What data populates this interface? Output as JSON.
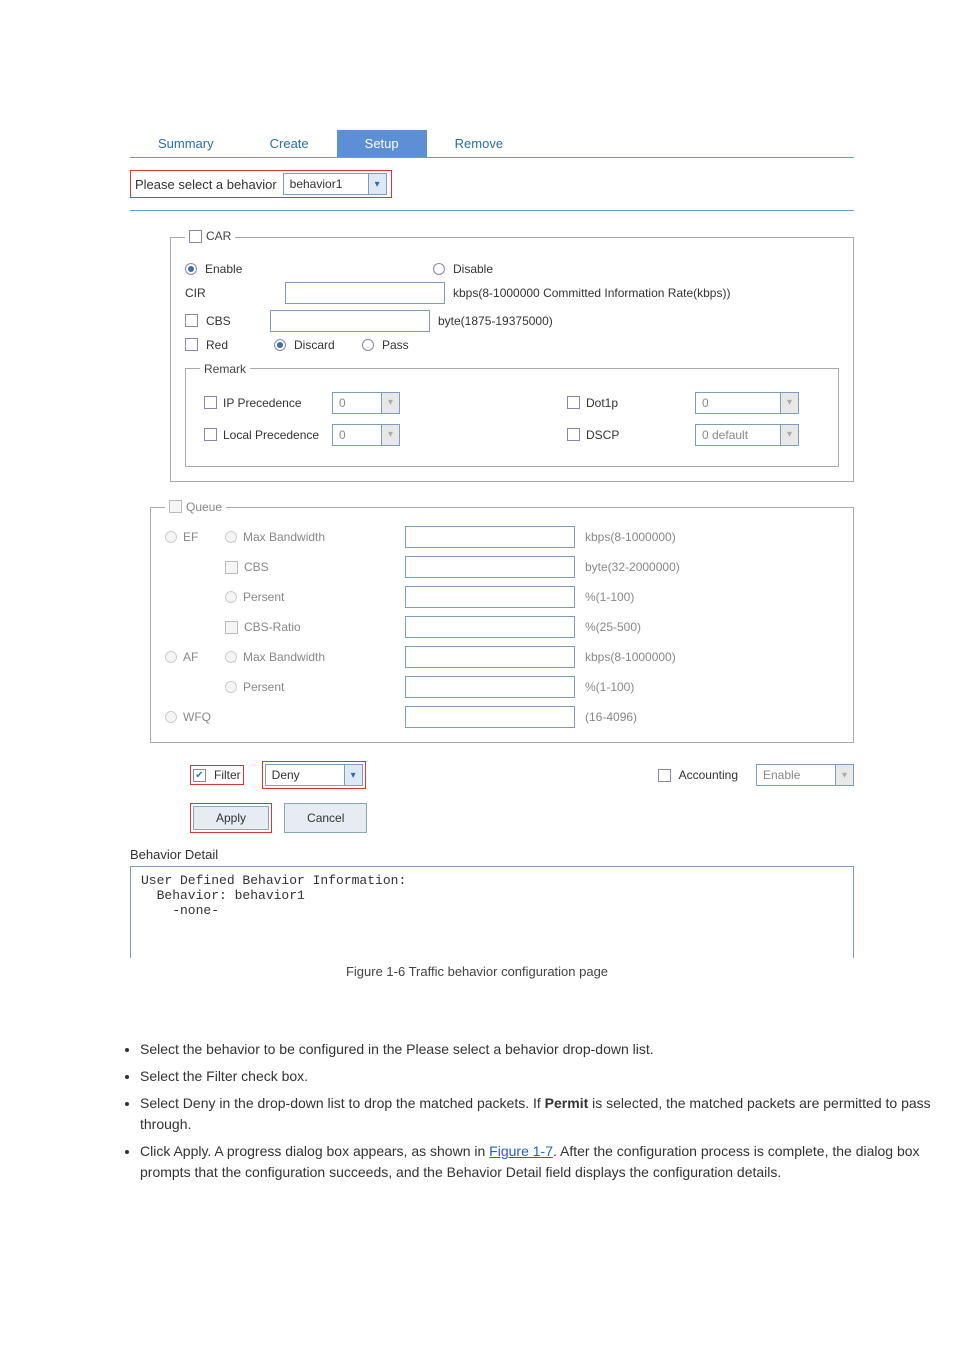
{
  "tabs": {
    "summary": "Summary",
    "create": "Create",
    "setup": "Setup",
    "remove": "Remove"
  },
  "select_label": "Please select a behavior",
  "behavior_value": "behavior1",
  "car": {
    "legend": "CAR",
    "enable": "Enable",
    "disable": "Disable",
    "cir_label": "CIR",
    "cir_unit": "kbps(8-1000000 Committed Information Rate(kbps))",
    "cbs_label": "CBS",
    "cbs_unit": "byte(1875-19375000)",
    "red_label": "Red",
    "discard": "Discard",
    "pass": "Pass"
  },
  "remark": {
    "legend": "Remark",
    "ip_precedence": "IP Precedence",
    "ip_val": "0",
    "dot1p": "Dot1p",
    "dot1p_val": "0",
    "local_precedence": "Local Precedence",
    "local_val": "0",
    "dscp": "DSCP",
    "dscp_val": "0 default"
  },
  "queue": {
    "legend": "Queue",
    "ef": "EF",
    "af": "AF",
    "wfq": "WFQ",
    "max_bw": "Max Bandwidth",
    "cbs": "CBS",
    "persent": "Persent",
    "cbs_ratio": "CBS-Ratio",
    "u_kbps": "kbps(8-1000000)",
    "u_byte": "byte(32-2000000)",
    "u_pct100": "%(1-100)",
    "u_pct500": "%(25-500)",
    "u_wfq": "(16-4096)"
  },
  "filter": {
    "label": "Filter",
    "value": "Deny",
    "accounting": "Accounting",
    "acct_value": "Enable"
  },
  "buttons": {
    "apply": "Apply",
    "cancel": "Cancel"
  },
  "detail_title": "Behavior Detail",
  "detail_body": "User Defined Behavior Information:\n  Behavior: behavior1\n    -none-",
  "caption": "Figure 1-6 Traffic behavior configuration page",
  "instructions": {
    "i1": "Select the behavior to be configured in the Please select a behavior drop-down list.",
    "i2": "Select the Filter check box.",
    "i3_a": "Select Deny in the drop-down list to drop the matched packets. If ",
    "i3_b": "Permit",
    "i3_c": " is selected, the matched packets are permitted to pass through.",
    "i4_a": "Click Apply. A progress dialog box appears, as shown in ",
    "i4_link": "Figure 1-7",
    "i4_b": ". After the configuration process is complete, the dialog box prompts that the configuration succeeds, and the Behavior Detail field displays the configuration details."
  }
}
